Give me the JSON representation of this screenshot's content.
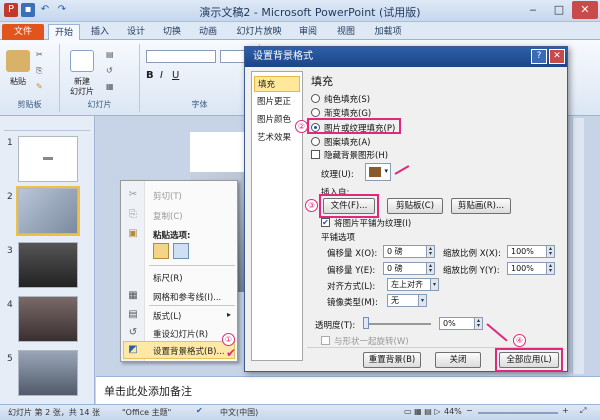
{
  "window": {
    "title": "演示文稿2 - Microsoft PowerPoint (试用版)"
  },
  "tabs": [
    "文件",
    "开始",
    "插入",
    "设计",
    "切换",
    "动画",
    "幻灯片放映",
    "审阅",
    "视图",
    "加载项"
  ],
  "ribbon": {
    "paste": "粘贴",
    "new_slide_1": "新建",
    "new_slide_2": "幻灯片",
    "groups": [
      "剪贴板",
      "幻灯片",
      "字体"
    ]
  },
  "thumbnails": [
    "1",
    "2",
    "3",
    "4",
    "5"
  ],
  "context_menu": {
    "cut": "剪切(T)",
    "copy": "复制(C)",
    "paste_options": "粘贴选项:",
    "ruler": "标尺(R)",
    "grid": "网格和参考线(I)...",
    "layout": "版式(L)",
    "reset": "重设幻灯片(R)",
    "format_bg": "设置背景格式(B)..."
  },
  "dialog": {
    "title": "设置背景格式",
    "categories": [
      "填充",
      "图片更正",
      "图片颜色",
      "艺术效果"
    ],
    "section": "填充",
    "options": [
      "纯色填充(S)",
      "渐变填充(G)",
      "图片或纹理填充(P)",
      "图案填充(A)"
    ],
    "hide_bg": "隐藏背景图形(H)",
    "texture": "纹理(U):",
    "insert_from": "插入自:",
    "file_btn": "文件(F)...",
    "clipboard_btn": "剪贴板(C)",
    "clipart_btn": "剪贴画(R)...",
    "tile_chk": "将图片平铺为纹理(I)",
    "tile_opts": "平铺选项",
    "offset_x": "偏移量 X(O):",
    "offset_x_val": "0 磅",
    "offset_y": "偏移量 Y(E):",
    "offset_y_val": "0 磅",
    "scale_x": "缩放比例 X(X):",
    "scale_x_val": "100%",
    "scale_y": "缩放比例 Y(Y):",
    "scale_y_val": "100%",
    "align": "对齐方式(L):",
    "align_val": "左上对齐",
    "mirror": "镜像类型(M):",
    "mirror_val": "无",
    "transparency": "透明度(T):",
    "transparency_val": "0%",
    "rotate_chk": "与形状一起旋转(W)",
    "reset_btn": "重置背景(B)",
    "close_btn": "关闭",
    "apply_all_btn": "全部应用(L)"
  },
  "markers": [
    "①",
    "②",
    "③",
    "④"
  ],
  "notes": "单击此处添加备注",
  "status": {
    "slide": "幻灯片 第 2 张，共 14 张",
    "theme": "\"Office 主题\"",
    "lang": "中文(中国)",
    "zoom": "44%"
  },
  "colors": {
    "accent": "#e0287c",
    "file_tab": "#e1541c",
    "dialog_title": "#1b4587"
  }
}
